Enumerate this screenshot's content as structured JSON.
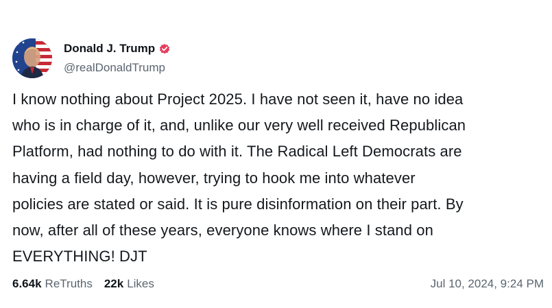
{
  "author": {
    "display_name": "Donald J. Trump",
    "handle": "@realDonaldTrump",
    "verified_icon": "verified-badge-icon",
    "accent_color": "#e4405f"
  },
  "post": {
    "text": "I know nothing about Project 2025. I have not seen it, have no idea\nwho is in charge of it, and, unlike our very well received Republican\nPlatform, had nothing to do with it. The Radical Left Democrats are\nhaving a field day, however, trying to hook me into whatever\npolicies are stated or said. It is pure disinformation on their part. By\nnow, after all of these years, everyone knows where I stand on\nEVERYTHING!  DJT"
  },
  "stats": {
    "retruths_count": "6.64k",
    "retruths_label": "ReTruths",
    "likes_count": "22k",
    "likes_label": "Likes"
  },
  "timestamp": "Jul 10, 2024, 9:24 PM"
}
